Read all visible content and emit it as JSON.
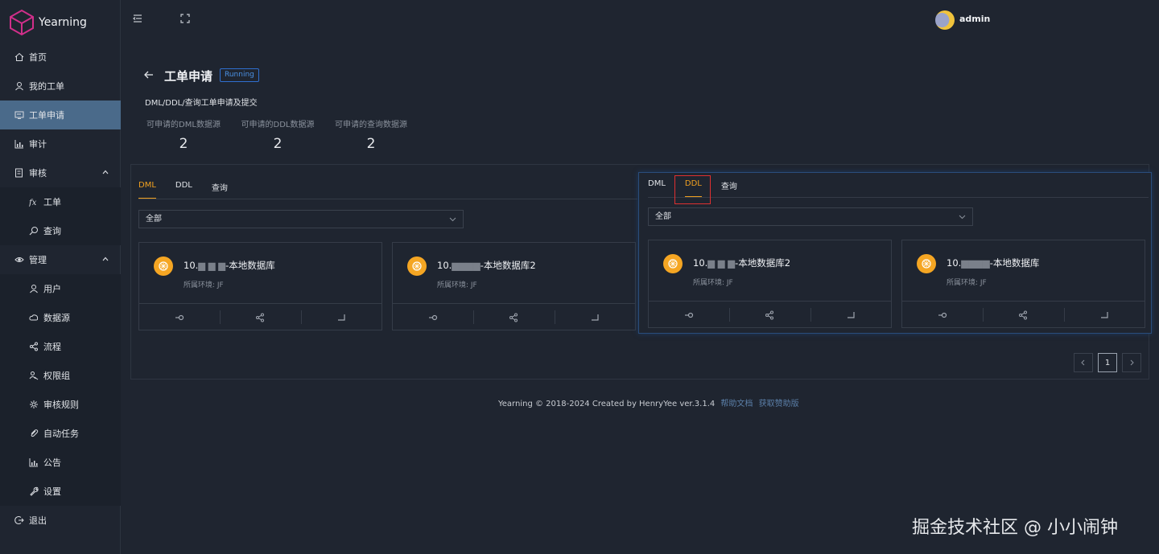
{
  "app": {
    "name": "Yearning"
  },
  "user": {
    "name": "admin"
  },
  "sidebar": {
    "items": [
      {
        "label": "首页",
        "icon": "home-icon"
      },
      {
        "label": "我的工单",
        "icon": "user-icon"
      },
      {
        "label": "工单申请",
        "icon": "ticket-icon",
        "active": true
      },
      {
        "label": "审计",
        "icon": "chart-icon"
      },
      {
        "label": "审核",
        "icon": "review-icon",
        "expandable": true
      },
      {
        "label": "工单",
        "icon": "fx-icon",
        "sub": true
      },
      {
        "label": "查询",
        "icon": "search-icon",
        "sub": true
      },
      {
        "label": "管理",
        "icon": "eye-icon",
        "expandable": true
      },
      {
        "label": "用户",
        "icon": "user-icon",
        "sub": true
      },
      {
        "label": "数据源",
        "icon": "cloud-icon",
        "sub": true
      },
      {
        "label": "流程",
        "icon": "share-icon",
        "sub": true
      },
      {
        "label": "权限组",
        "icon": "group-icon",
        "sub": true
      },
      {
        "label": "审核规则",
        "icon": "gear-icon",
        "sub": true
      },
      {
        "label": "自动任务",
        "icon": "attach-icon",
        "sub": true
      },
      {
        "label": "公告",
        "icon": "chart-icon",
        "sub": true
      },
      {
        "label": "设置",
        "icon": "wrench-icon",
        "sub": true
      },
      {
        "label": "退出",
        "icon": "logout-icon"
      }
    ]
  },
  "header": {
    "title": "工单申请",
    "status": "Running",
    "subtitle": "DML/DDL/查询工单申请及提交",
    "stats": [
      {
        "label": "可申请的DML数据源",
        "value": "2"
      },
      {
        "label": "可申请的DDL数据源",
        "value": "2"
      },
      {
        "label": "可申请的查询数据源",
        "value": "2"
      }
    ]
  },
  "main_panel": {
    "tabs": [
      "DML",
      "DDL",
      "查询"
    ],
    "select_value": "全部",
    "cards": [
      {
        "title_prefix": "10.",
        "title_suffix": "-本地数据库",
        "env": "所属环境: JF"
      },
      {
        "title_prefix": "10.",
        "title_suffix": "-本地数据库2",
        "env": "所属环境: JF"
      }
    ]
  },
  "overlay_panel": {
    "tabs": [
      "DML",
      "DDL",
      "查询"
    ],
    "select_value": "全部",
    "cards": [
      {
        "title_prefix": "10.",
        "title_suffix": "-本地数据库2",
        "env": "所属环境: JF"
      },
      {
        "title_prefix": "10.",
        "title_suffix": "-本地数据库",
        "env": "所属环境: JF"
      }
    ]
  },
  "pagination": {
    "current": "1"
  },
  "footer": {
    "text": "Yearning © 2018-2024 Created by HenryYee ver.3.1.4",
    "link1": "帮助文档",
    "link2": "获取赞助版"
  },
  "watermark": "掘金技术社区 @ 小小闹钟",
  "colors": {
    "accent": "#f0a020",
    "active_nav": "#4a6a8a",
    "tag_blue": "#2f6fd0",
    "highlight": "#e03030"
  }
}
